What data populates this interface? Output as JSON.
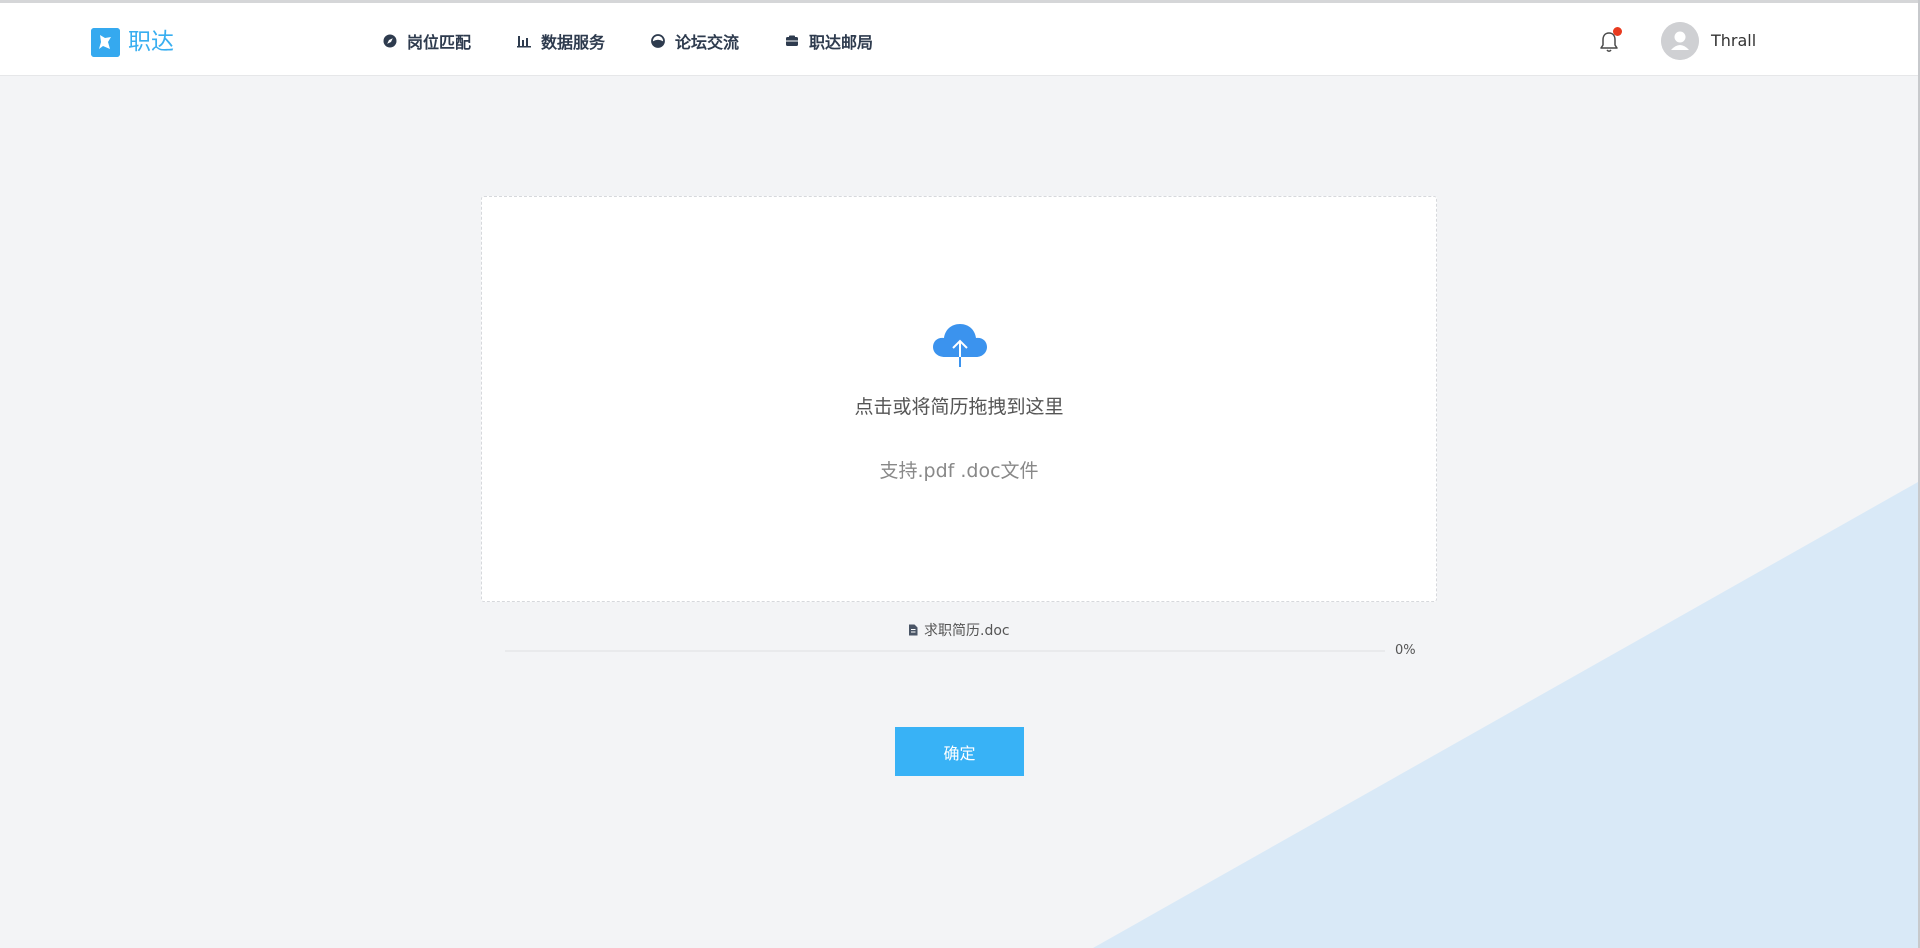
{
  "brand": {
    "name": "职达",
    "color": "#38aef0"
  },
  "nav": {
    "items": [
      {
        "label": "岗位匹配",
        "icon": "compass-icon"
      },
      {
        "label": "数据服务",
        "icon": "bar-chart-icon"
      },
      {
        "label": "论坛交流",
        "icon": "forum-icon"
      },
      {
        "label": "职达邮局",
        "icon": "mailbox-icon"
      }
    ]
  },
  "user": {
    "name": "Thrall",
    "notification_icon": "bell-icon",
    "has_unread": true
  },
  "upload": {
    "icon": "cloud-upload-icon",
    "prompt": "点击或将简历拖拽到这里",
    "hint": "支持.pdf .doc文件"
  },
  "file": {
    "icon": "file-icon",
    "name": "求职简历.doc",
    "progress": 0,
    "progress_label": "0%"
  },
  "actions": {
    "confirm_label": "确定"
  },
  "colors": {
    "accent": "#38b2f6",
    "background": "#f3f4f6",
    "decoration": "#d9e9f7",
    "notification": "#e83a1f"
  }
}
